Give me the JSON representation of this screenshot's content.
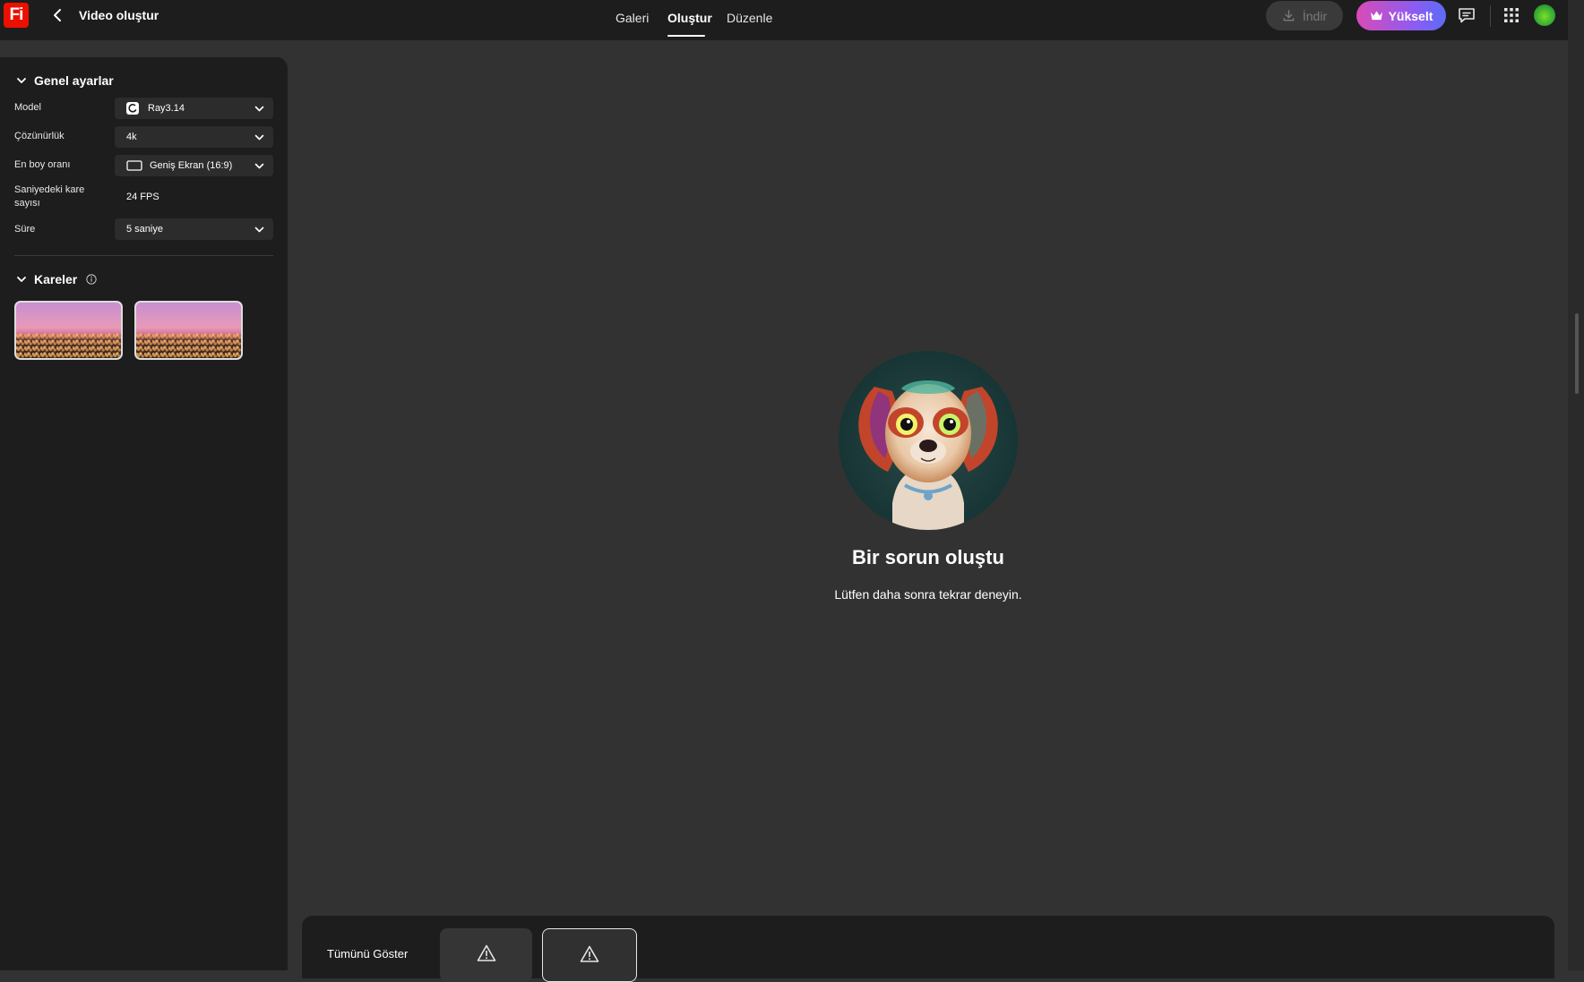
{
  "header": {
    "logo_text": "Fi",
    "title": "Video oluştur",
    "tabs": [
      {
        "label": "Galeri"
      },
      {
        "label": "Oluştur"
      },
      {
        "label": "Düzenle"
      }
    ],
    "download_label": "İndir",
    "upgrade_label": "Yükselt"
  },
  "panel": {
    "general_title": "Genel ayarlar",
    "fields": {
      "model": {
        "label": "Model",
        "value": "Ray3.14"
      },
      "resolution": {
        "label": "Çözünürlük",
        "value": "4k"
      },
      "aspect": {
        "label": "En boy oranı",
        "value": "Geniş Ekran (16:9)"
      },
      "fps": {
        "label": "Saniyedeki kare sayısı",
        "value": "24 FPS"
      },
      "duration": {
        "label": "Süre",
        "value": "5 saniye"
      }
    },
    "frames_title": "Kareler"
  },
  "main": {
    "error_title": "Bir sorun oluştu",
    "error_subtitle": "Lütfen daha sonra tekrar deneyin."
  },
  "bottom": {
    "show_all_label": "Tümünü Göster"
  },
  "colors": {
    "accent_red": "#eb1000",
    "upgrade_gradient_start": "#d94bb7",
    "upgrade_gradient_end": "#5b6cf5"
  }
}
